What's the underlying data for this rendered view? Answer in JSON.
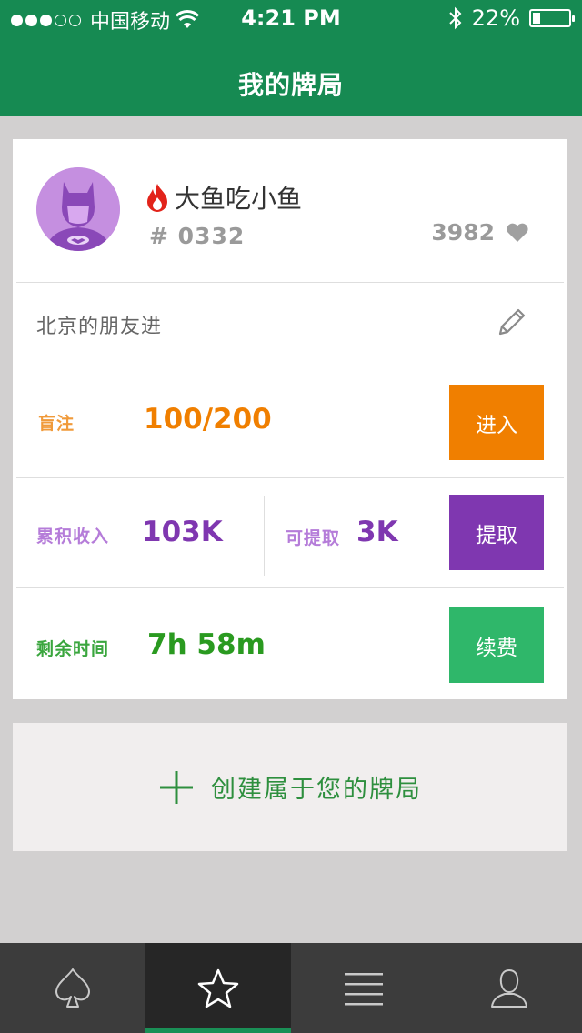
{
  "status_bar": {
    "carrier": "中国移动",
    "time": "4:21 PM",
    "battery": "22%",
    "battery_level": 0.22
  },
  "nav": {
    "title": "我的牌局"
  },
  "game_card": {
    "user": {
      "name": "大鱼吃小鱼",
      "id": "# 0332",
      "likes": "3982"
    },
    "description": "北京的朋友进",
    "blinds": {
      "label": "盲注",
      "value": "100/200",
      "button": "进入"
    },
    "income": {
      "label": "累积收入",
      "value": "103K",
      "withdrawable_label": "可提取",
      "withdrawable_value": "3K",
      "button": "提取"
    },
    "time_left": {
      "label": "剩余时间",
      "value": "7h 58m",
      "button": "续费"
    }
  },
  "create": {
    "label": "创建属于您的牌局"
  },
  "tabs": [
    {
      "icon": "spade-icon",
      "active": false
    },
    {
      "icon": "star-icon",
      "active": true
    },
    {
      "icon": "menu-icon",
      "active": false
    },
    {
      "icon": "user-icon",
      "active": false
    }
  ],
  "colors": {
    "header": "#168a52",
    "orange": "#f07f00",
    "purple": "#7f37b0",
    "green": "#2fb76a",
    "time_green": "#2a9a20",
    "tab_active_indicator": "#1a8f56"
  }
}
